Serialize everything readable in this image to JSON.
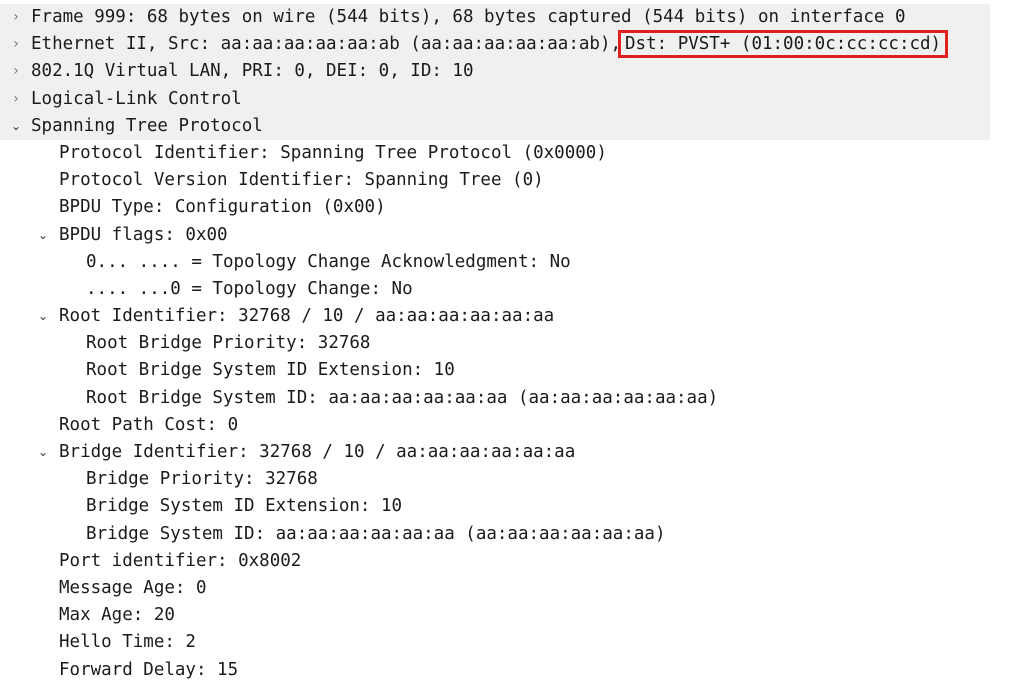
{
  "tree": {
    "frame": "Frame 999: 68 bytes on wire (544 bits), 68 bytes captured (544 bits) on interface 0",
    "ethernet_prefix": "Ethernet II, Src: aa:aa:aa:aa:aa:ab (aa:aa:aa:aa:aa:ab),",
    "ethernet_dst": "Dst: PVST+ (01:00:0c:cc:cc:cd)",
    "vlan": "802.1Q Virtual LAN, PRI: 0, DEI: 0, ID: 10",
    "llc": "Logical-Link Control",
    "stp": "Spanning Tree Protocol",
    "protocol_identifier": "Protocol Identifier: Spanning Tree Protocol (0x0000)",
    "protocol_version": "Protocol Version Identifier: Spanning Tree (0)",
    "bpdu_type": "BPDU Type: Configuration (0x00)",
    "bpdu_flags": "BPDU flags: 0x00",
    "flag_tca": "0... .... = Topology Change Acknowledgment: No",
    "flag_tc": ".... ...0 = Topology Change: No",
    "root_identifier": "Root Identifier: 32768 / 10 / aa:aa:aa:aa:aa:aa",
    "root_bridge_priority": "Root Bridge Priority: 32768",
    "root_bridge_ext": "Root Bridge System ID Extension: 10",
    "root_bridge_id": "Root Bridge System ID: aa:aa:aa:aa:aa:aa (aa:aa:aa:aa:aa:aa)",
    "root_path_cost": "Root Path Cost: 0",
    "bridge_identifier": "Bridge Identifier: 32768 / 10 / aa:aa:aa:aa:aa:aa",
    "bridge_priority": "Bridge Priority: 32768",
    "bridge_ext": "Bridge System ID Extension: 10",
    "bridge_id": "Bridge System ID: aa:aa:aa:aa:aa:aa (aa:aa:aa:aa:aa:aa)",
    "port_identifier": "Port identifier: 0x8002",
    "message_age": "Message Age: 0",
    "max_age": "Max Age: 20",
    "hello_time": "Hello Time: 2",
    "forward_delay": "Forward Delay: 15"
  },
  "icons": {
    "collapsed": "chevron-right-icon",
    "expanded": "chevron-down-icon"
  },
  "colors": {
    "highlight_box": "#e0201e",
    "band": "#f0f0f0"
  }
}
